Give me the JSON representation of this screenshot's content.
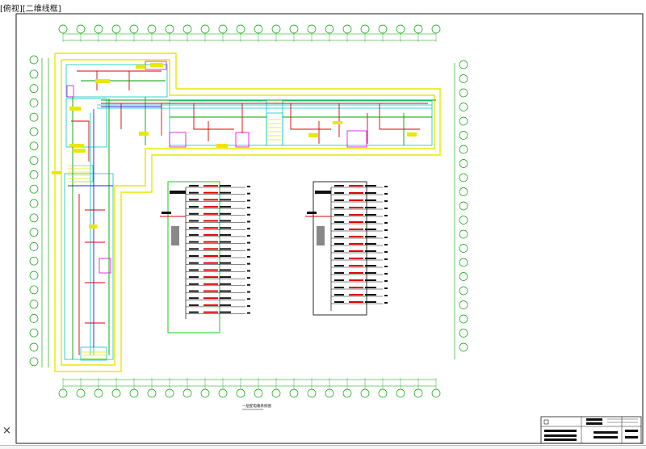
{
  "window": {
    "viewport_label": "[俯视][二维线框]"
  },
  "drawing": {
    "background": "#ffffff",
    "colors": {
      "frame": "#1a1a1a",
      "wall": "#e8e800",
      "cyan": "#00c8c8",
      "red": "#e00000",
      "green": "#00a000",
      "blue": "#2020e0",
      "magenta": "#e000e0"
    },
    "panel_caption": "一层配电箱系统图"
  },
  "controls": {
    "close_icon": "×"
  }
}
